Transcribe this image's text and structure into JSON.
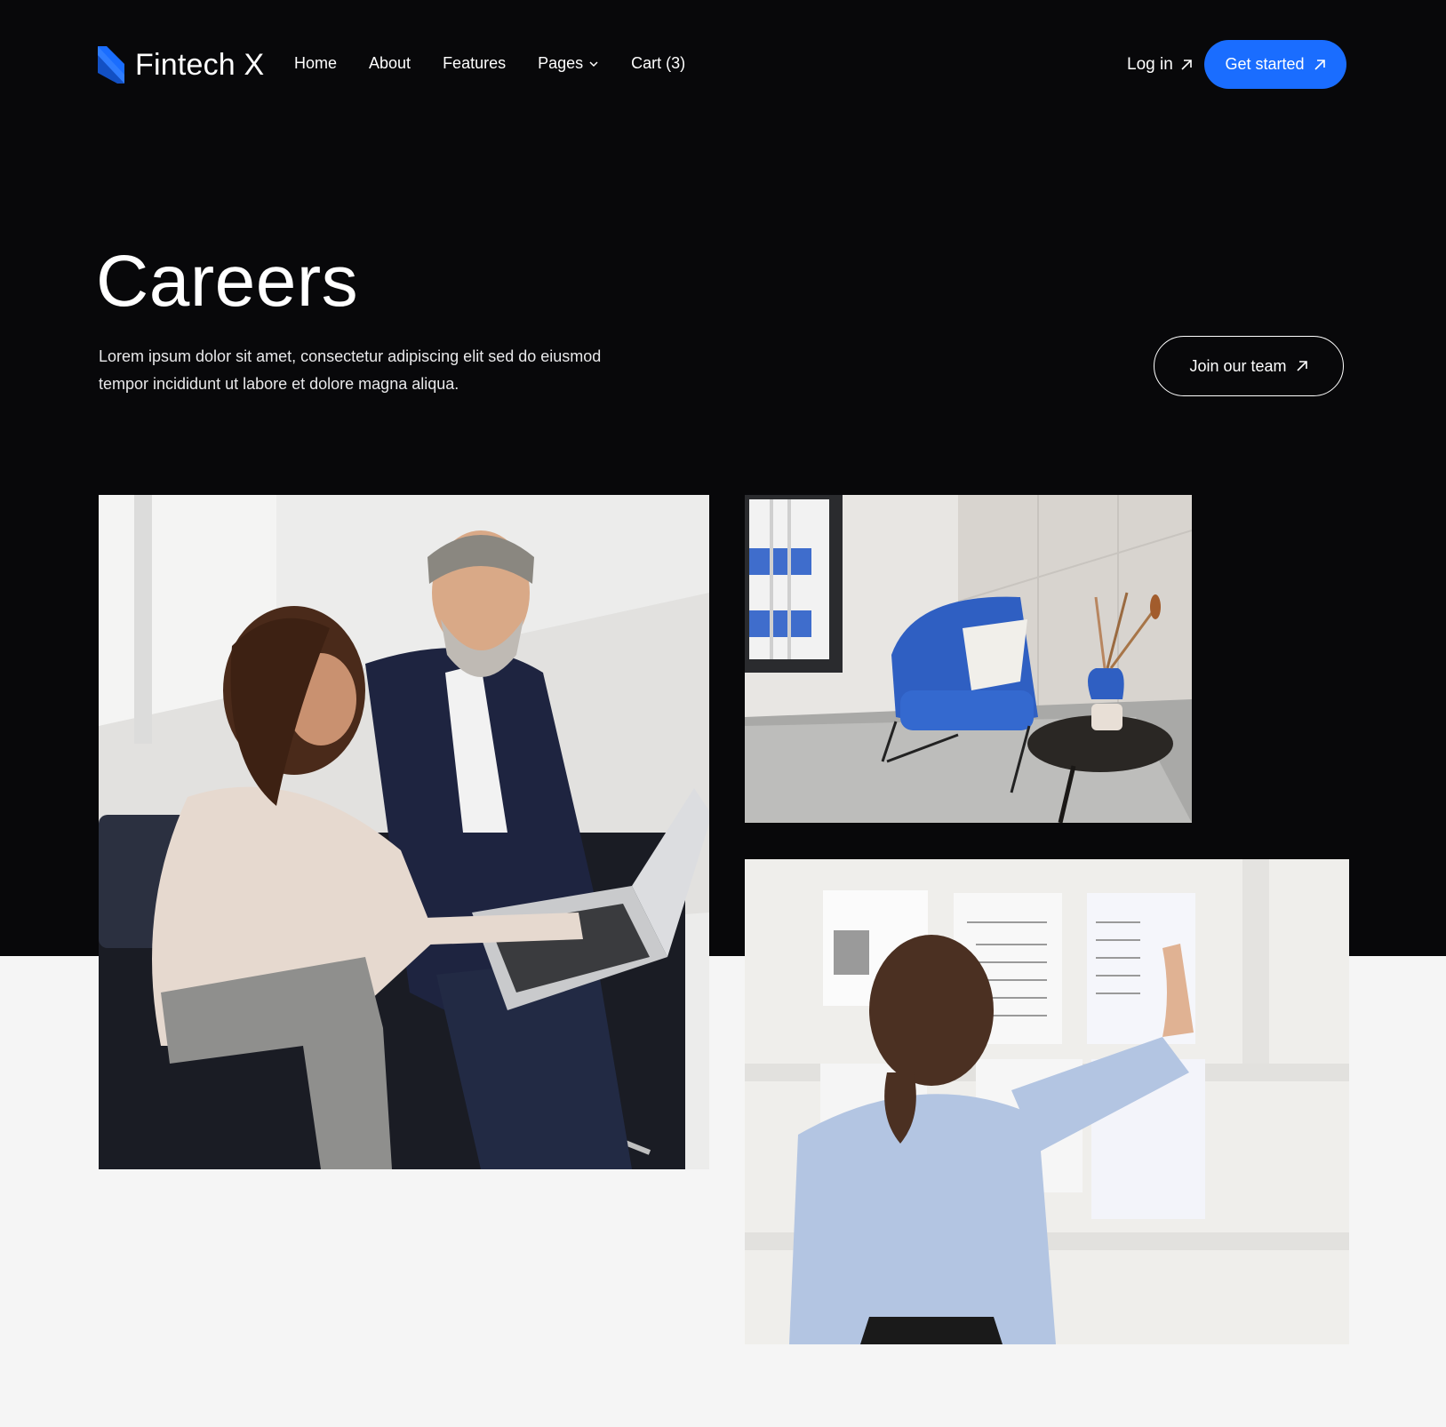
{
  "brand": {
    "name": "Fintech X",
    "accent": "#1a6dff",
    "logo_icon": "fintech-x-logo-icon"
  },
  "nav": {
    "links": [
      {
        "label": "Home"
      },
      {
        "label": "About"
      },
      {
        "label": "Features"
      },
      {
        "label": "Pages",
        "icon": "chevron-down-icon"
      },
      {
        "label": "Cart (3)"
      }
    ],
    "login_label": "Log in",
    "cta_label": "Get started"
  },
  "hero": {
    "title": "Careers",
    "description": "Lorem ipsum dolor sit amet, consectetur adipiscing elit sed do eiusmod tempor incididunt ut labore et dolore magna aliqua.",
    "cta_label": "Join our team"
  },
  "colors": {
    "dark_bg": "#08080a",
    "light_bg": "#f5f5f5",
    "primary": "#1a6dff",
    "text_light": "#ffffff"
  },
  "images": [
    {
      "id": "team-meeting-photo"
    },
    {
      "id": "office-lounge-photo"
    },
    {
      "id": "planning-board-photo"
    }
  ]
}
